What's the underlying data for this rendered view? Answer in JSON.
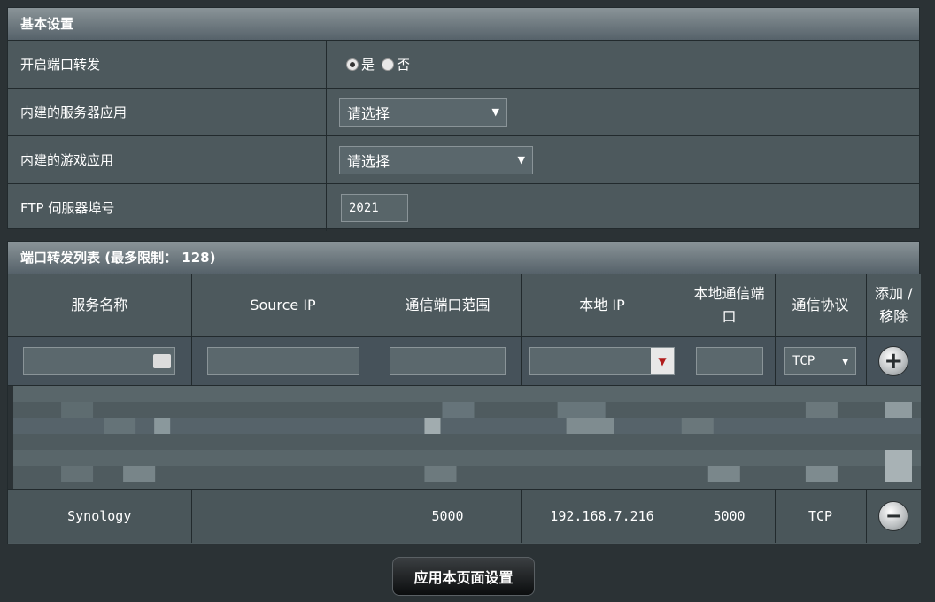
{
  "basic": {
    "title": "基本设置",
    "port_forward_label": "开启端口转发",
    "yes_label": "是",
    "no_label": "否",
    "server_app_label": "内建的服务器应用",
    "server_app_value": "请选择",
    "game_app_label": "内建的游戏应用",
    "game_app_value": "请选择",
    "ftp_label": "FTP 伺服器埠号",
    "ftp_value": "2021"
  },
  "list": {
    "title": "端口转发列表 (最多限制： 128)",
    "headers": [
      "服务名称",
      "Source IP",
      "通信端口范围",
      "本地 IP",
      "本地通信端口",
      "通信协议",
      "添加 / 移除"
    ],
    "protocol_select": "TCP",
    "rows": [
      {
        "service": "Synology",
        "source_ip": "",
        "port_range": "5000",
        "local_ip": "192.168.7.216",
        "local_port": "5000",
        "protocol": "TCP"
      }
    ]
  },
  "apply_label": "应用本页面设置",
  "colors": {
    "panel": "#4d595d",
    "background": "#2b3235",
    "header_gradient_top": "#8a9498"
  },
  "icons": [
    "id-card-icon",
    "dropdown-arrow-icon",
    "add-icon",
    "remove-icon"
  ]
}
